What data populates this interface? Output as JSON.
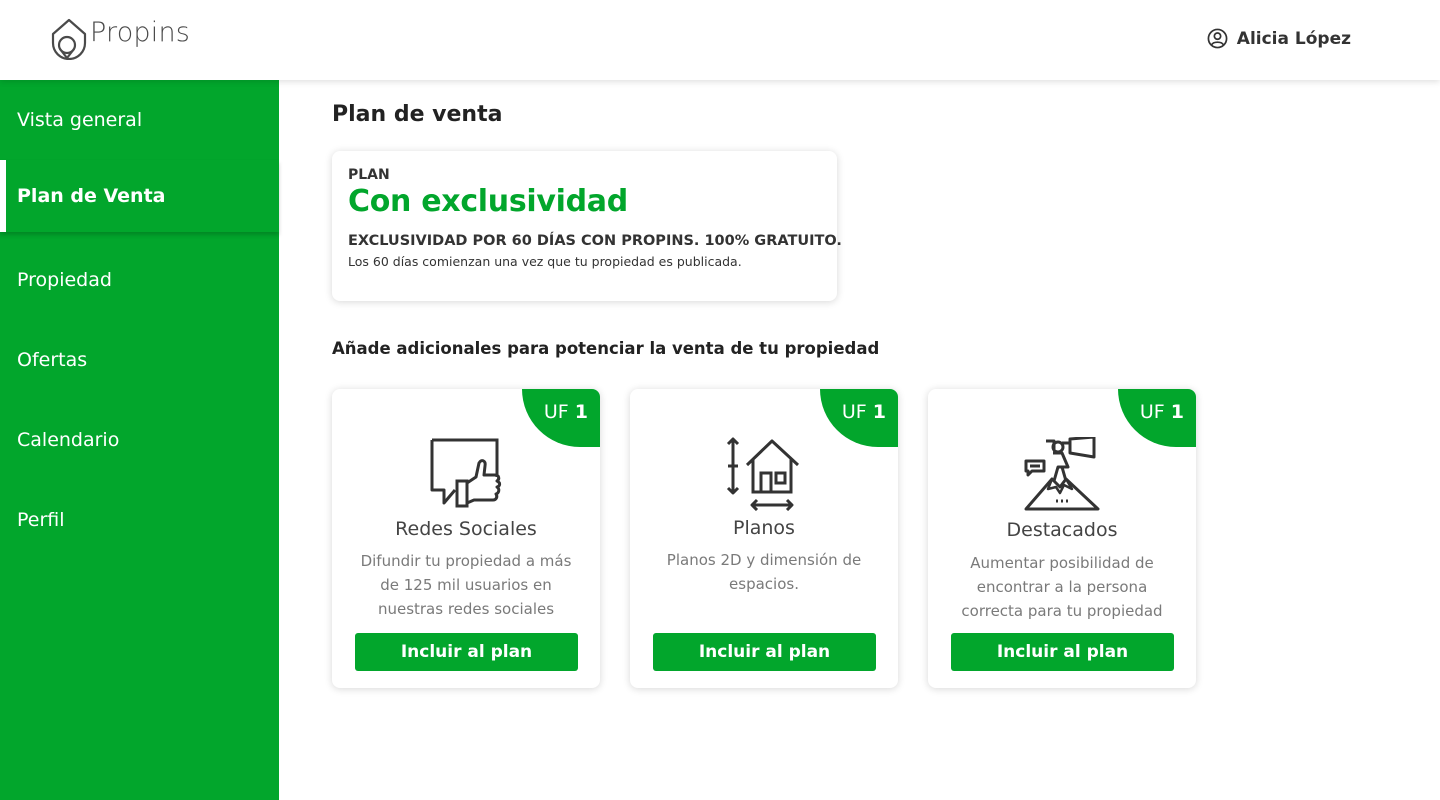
{
  "header": {
    "logo_text": "Propins",
    "user_name": "Alicia López"
  },
  "sidebar": {
    "items": [
      {
        "label": "Vista general",
        "active": false
      },
      {
        "label": "Plan de Venta",
        "active": true
      },
      {
        "label": "Propiedad",
        "active": false
      },
      {
        "label": "Ofertas",
        "active": false
      },
      {
        "label": "Calendario",
        "active": false
      },
      {
        "label": "Perfil",
        "active": false
      }
    ]
  },
  "main": {
    "title": "Plan de venta",
    "plan": {
      "label": "PLAN",
      "name": "Con exclusividad",
      "description": "EXCLUSIVIDAD POR 60 DÍAS CON PROPINS. 100% GRATUITO.",
      "note": "Los 60 días comienzan una vez que tu propiedad es publicada."
    },
    "addons_title": "Añade adicionales para potenciar la venta de tu propiedad",
    "addons": [
      {
        "badge_unit": "UF",
        "badge_value": "1",
        "icon": "social-like-icon",
        "title": "Redes Sociales",
        "text": "Difundir tu propiedad a más de 125 mil usuarios en nuestras redes sociales",
        "button": "Incluir al plan"
      },
      {
        "badge_unit": "UF",
        "badge_value": "1",
        "icon": "house-plan-icon",
        "title": "Planos",
        "text": "Planos 2D y dimensión de espacios.",
        "button": "Incluir al plan"
      },
      {
        "badge_unit": "UF",
        "badge_value": "1",
        "icon": "megaphone-mountain-icon",
        "title": "Destacados",
        "text": "Aumentar posibilidad de encontrar a la persona correcta para tu propiedad",
        "button": "Incluir al plan"
      }
    ]
  },
  "colors": {
    "brand_green": "#02a62c",
    "text_dark": "#222222",
    "text_muted": "#7a7a7a"
  }
}
